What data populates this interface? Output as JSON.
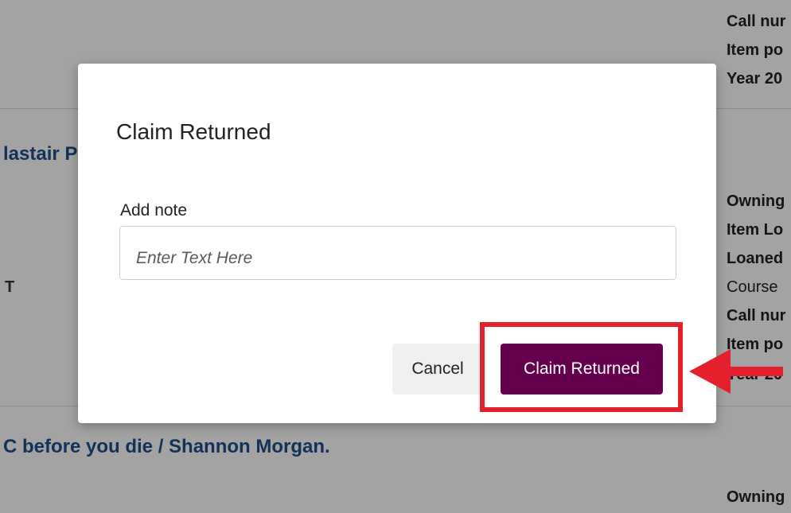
{
  "background": {
    "dividers": [],
    "titles": [
      "lastair P",
      "C before you die / Shannon Morgan."
    ],
    "left_labels": [
      "T"
    ],
    "right_lines": [
      {
        "text": "Call nur",
        "bold": true
      },
      {
        "text": "Item po",
        "bold": true
      },
      {
        "text": "Year 20",
        "bold": true
      },
      {
        "text": "Owning",
        "bold": true
      },
      {
        "text": "Item Lo",
        "bold": true
      },
      {
        "text": "Loaned",
        "bold": true
      },
      {
        "text": "Course",
        "bold": false
      },
      {
        "text": "Call nur",
        "bold": true
      },
      {
        "text": "Item po",
        "bold": true
      },
      {
        "text": "Year 20",
        "bold": true
      },
      {
        "text": "Owning",
        "bold": true
      }
    ]
  },
  "dialog": {
    "title": "Claim Returned",
    "note_label": "Add note",
    "note_value": "",
    "note_placeholder": "Enter Text Here",
    "cancel_label": "Cancel",
    "confirm_label": "Claim Returned"
  },
  "annotation": {
    "highlight_color": "#e3202b",
    "arrow_icon": "arrow-left-icon"
  },
  "colors": {
    "primary_button": "#65004f",
    "link_text": "#1f4e8c"
  }
}
